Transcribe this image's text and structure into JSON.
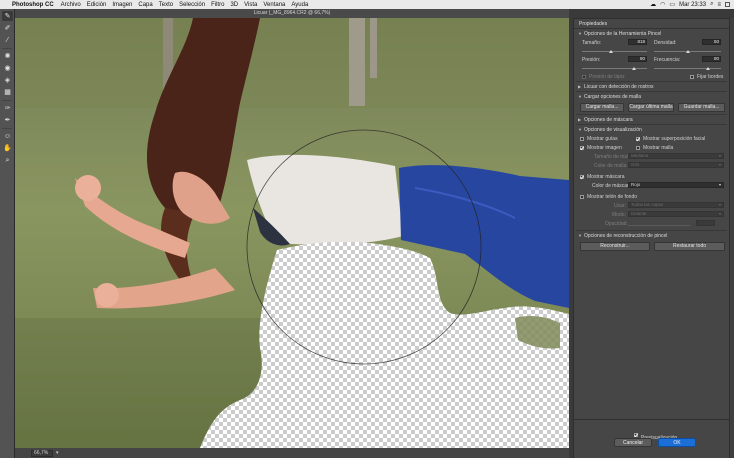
{
  "menubar": {
    "app_name": "Photoshop CC",
    "items": [
      "Archivo",
      "Edición",
      "Imagen",
      "Capa",
      "Texto",
      "Selección",
      "Filtro",
      "3D",
      "Vista",
      "Ventana",
      "Ayuda"
    ],
    "clock": "Mar 23:33"
  },
  "document": {
    "title": "Licuar (_MG_8964.CR2 @ 66,7%)",
    "zoom": "66,7%"
  },
  "panel": {
    "title": "Propiedades",
    "tool_options": {
      "header": "Opciones de la Herramienta Pincel",
      "size_label": "Tamaño:",
      "size_value": "818",
      "size_fraction": 0.45,
      "density_label": "Densidad:",
      "density_value": "50",
      "density_fraction": 0.5,
      "pressure_label": "Presión:",
      "pressure_value": "80",
      "pressure_fraction": 0.8,
      "rate_label": "Frecuencia:",
      "rate_value": "80",
      "rate_fraction": 0.8,
      "stylus_label": "Presión de lápiz",
      "pin_edges_label": "Fijar bordes"
    },
    "face_aware": {
      "header": "Licuar con detección de rostros"
    },
    "load_mesh": {
      "header": "Cargar opciones de malla",
      "load_mesh_btn": "Cargar malla...",
      "load_last_btn": "Cargar última malla",
      "save_mesh_btn": "Guardar malla..."
    },
    "mask_options": {
      "header": "Opciones de máscara"
    },
    "view_options": {
      "header": "Opciones de visualización",
      "show_guides": "Mostrar guías",
      "show_face_overlay": "Mostrar superposición facial",
      "show_image": "Mostrar imagen",
      "show_mesh": "Mostrar malla",
      "mesh_size_label": "Tamaño de malla:",
      "mesh_size_value": "Mediana",
      "mesh_color_label": "Color de malla:",
      "mesh_color_value": "Gris",
      "show_mask": "Mostrar máscara",
      "mask_color_label": "Color de máscara:",
      "mask_color_value": "Rojo",
      "show_backdrop": "Mostrar telón de fondo",
      "use_label": "Usar:",
      "use_value": "Todas las capas",
      "mode_label": "Modo:",
      "mode_value": "Delante",
      "opacity_label": "Opacidad:"
    },
    "reconstruct": {
      "header": "Opciones de reconstrucción de pincel",
      "reconstruct_btn": "Reconstruir...",
      "restore_all_btn": "Restaurar todo"
    }
  },
  "footer": {
    "preview_label": "Previsualización",
    "cancel_label": "Cancelar",
    "ok_label": "OK"
  },
  "colors": {
    "accent": "#1c6fd6",
    "panel_bg": "#464646",
    "toolbar_bg": "#535353"
  }
}
